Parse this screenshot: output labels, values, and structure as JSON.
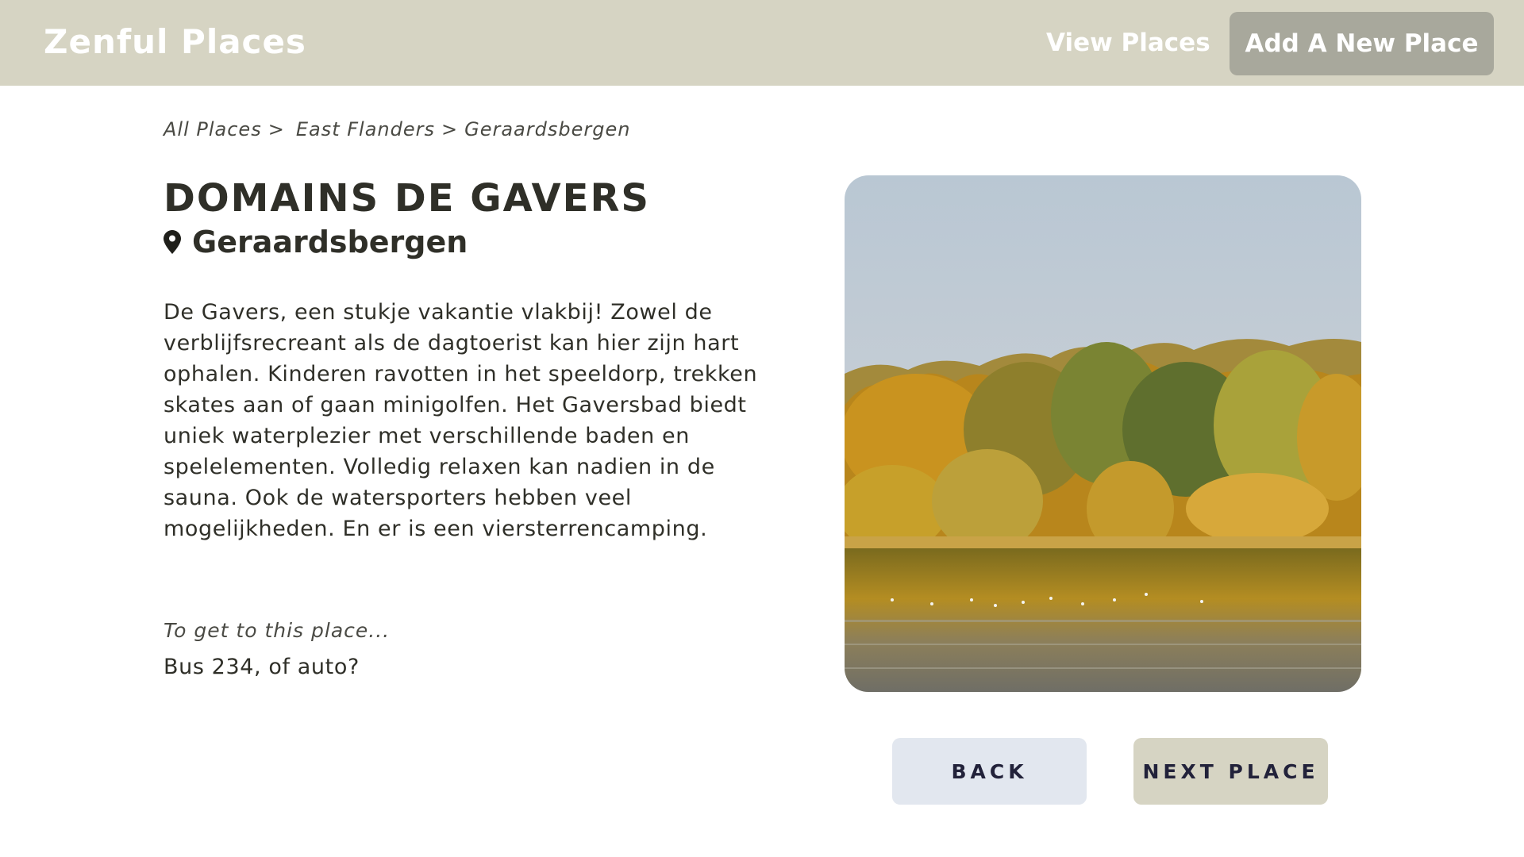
{
  "nav": {
    "brand": "Zenful Places",
    "view_places": "View Places",
    "add_place": "Add A New Place"
  },
  "breadcrumb": {
    "all": "All Places",
    "separator": ">",
    "region": "East Flanders",
    "city": "Geraardsbergen"
  },
  "place": {
    "title": "DOMAINS DE GAVERS",
    "location": "Geraardsbergen",
    "location_icon": "map-pin-icon",
    "description": "De Gavers, een stukje vakantie vlakbij! Zowel de verblijfsrecreant als de dagtoerist kan hier zijn hart ophalen. Kinderen ravotten in het speeldorp, trekken skates aan of gaan minigolfen. Het Gaversbad biedt uniek waterplezier met verschillende baden en spelelementen. Volledig relaxen kan nadien in de sauna. Ook de watersporters hebben veel mogelijkheden. En er is een viersterrencamping.",
    "directions_label": "To get to this place...",
    "directions": "Bus 234, of auto?"
  },
  "buttons": {
    "back": "BACK",
    "next": "NEXT PLACE"
  },
  "colors": {
    "navbar": "#d6d4c3",
    "add_button": "#a8a89c",
    "back_button": "#e2e7ef",
    "next_button": "#d6d4c3",
    "text": "#2f2f28"
  }
}
